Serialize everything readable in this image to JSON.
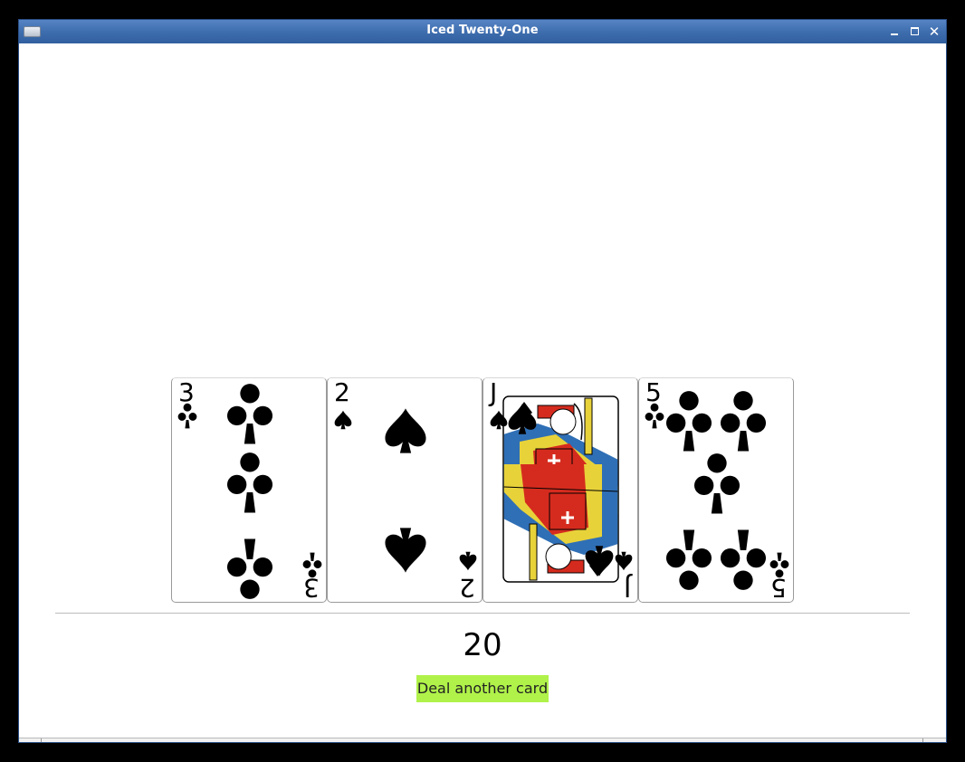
{
  "window": {
    "title": "Iced Twenty-One"
  },
  "titlebar": {
    "minimize": "",
    "maximize": "",
    "close": "✕"
  },
  "hand": [
    {
      "rank": "3",
      "suit": "clubs",
      "suit_symbol": "♣",
      "color": "#000000"
    },
    {
      "rank": "2",
      "suit": "spades",
      "suit_symbol": "♠",
      "color": "#000000"
    },
    {
      "rank": "J",
      "suit": "spades",
      "suit_symbol": "♠",
      "color": "#000000"
    },
    {
      "rank": "5",
      "suit": "clubs",
      "suit_symbol": "♣",
      "color": "#000000"
    }
  ],
  "score": "20",
  "deal_button": {
    "label": "Deal another card",
    "color": "#b0f24a"
  }
}
